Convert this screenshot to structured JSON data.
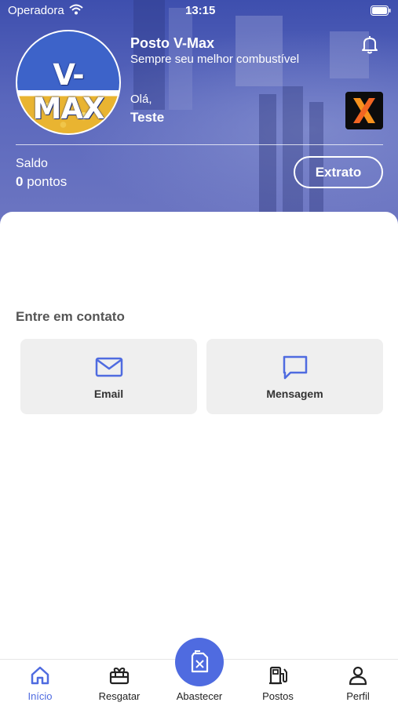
{
  "status_bar": {
    "carrier": "Operadora",
    "time": "13:15"
  },
  "header": {
    "logo_text": "V-MAX",
    "station_name": "Posto V-Max",
    "slogan": "Sempre seu melhor combustível",
    "greeting": "Olá,",
    "username": "Teste",
    "balance_label": "Saldo",
    "balance_value": "0",
    "balance_unit": "pontos",
    "extrato_label": "Extrato"
  },
  "contact": {
    "title": "Entre em contato",
    "cards": [
      {
        "label": "Email",
        "icon": "mail-icon"
      },
      {
        "label": "Mensagem",
        "icon": "chat-icon"
      }
    ]
  },
  "tabbar": {
    "active_color": "#4f6be0",
    "items": [
      {
        "label": "Início",
        "icon": "home-icon",
        "active": true
      },
      {
        "label": "Resgatar",
        "icon": "gift-icon",
        "active": false
      },
      {
        "label": "Abastecer",
        "icon": "fuel-can-icon",
        "active": false
      },
      {
        "label": "Postos",
        "icon": "gas-pump-icon",
        "active": false
      },
      {
        "label": "Perfil",
        "icon": "user-icon",
        "active": false
      }
    ]
  },
  "colors": {
    "header_bg": "#4b5ab5",
    "accent": "#4f6be0",
    "card_bg": "#efefef"
  }
}
